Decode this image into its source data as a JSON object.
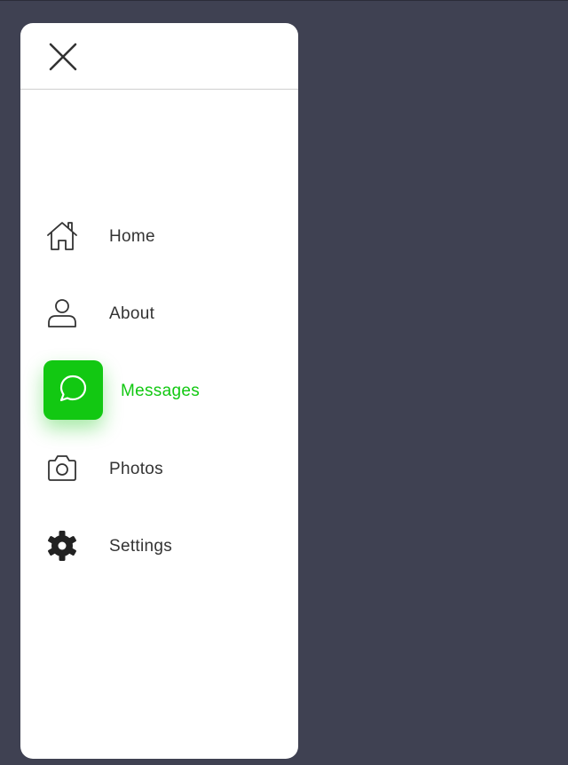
{
  "colors": {
    "background": "#3f4152",
    "panel": "#ffffff",
    "accent": "#12c812",
    "text": "#333333"
  },
  "header": {
    "close_icon": "close-icon"
  },
  "nav": {
    "items": [
      {
        "label": "Home",
        "icon": "home-icon",
        "active": false
      },
      {
        "label": "About",
        "icon": "user-icon",
        "active": false
      },
      {
        "label": "Messages",
        "icon": "chat-bubble-icon",
        "active": true
      },
      {
        "label": "Photos",
        "icon": "camera-icon",
        "active": false
      },
      {
        "label": "Settings",
        "icon": "gear-icon",
        "active": false
      }
    ]
  }
}
